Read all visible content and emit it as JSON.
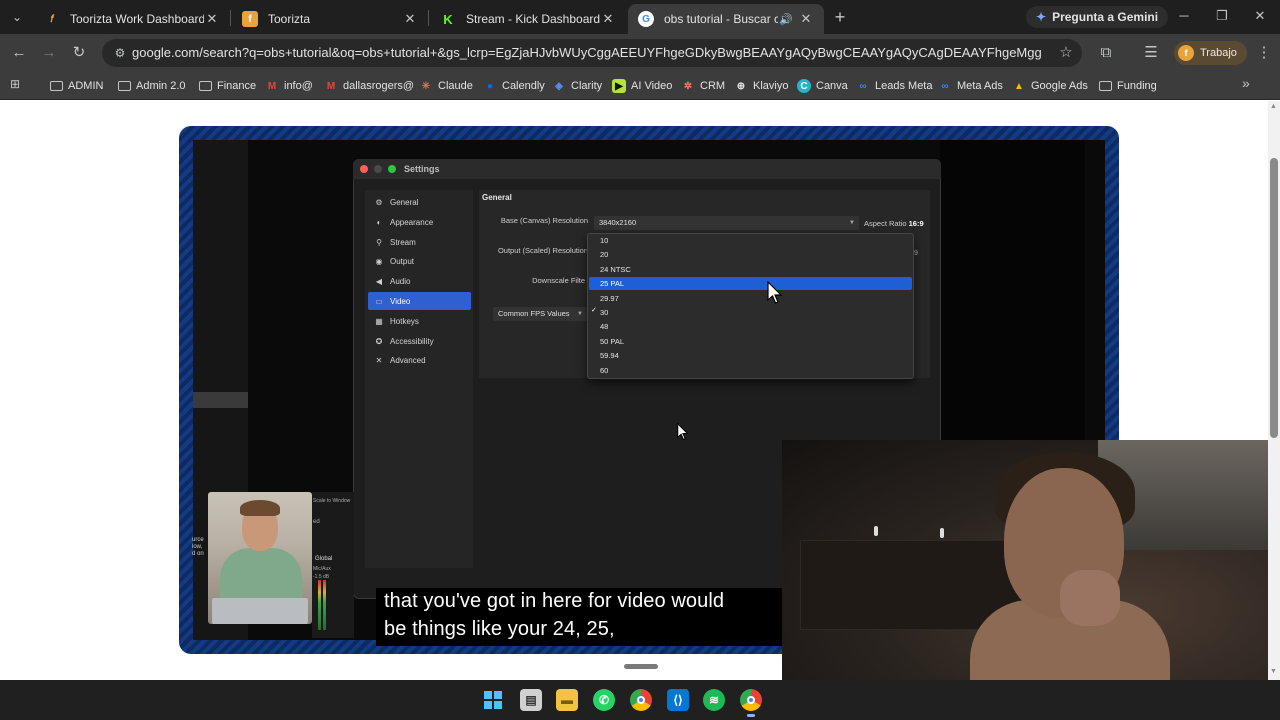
{
  "browser": {
    "tabs": [
      {
        "title": "Toorizta Work Dashboard",
        "favicon": "toorizta-leaf-icon",
        "close": "✕"
      },
      {
        "title": "Toorizta",
        "favicon": "toorizta-icon",
        "close": "✕"
      },
      {
        "title": "Stream - Kick Dashboard",
        "favicon": "kick-icon",
        "close": "✕"
      },
      {
        "title": "obs tutorial - Buscar con Google",
        "favicon": "google-icon",
        "close": "✕",
        "active": true,
        "audio": "🔊"
      }
    ],
    "new_tab": "+",
    "gemini_label": "Pregunta a Gemini",
    "url": "google.com/search?q=obs+tutorial&oq=obs+tutorial+&gs_lcrp=EgZjaHJvbWUyCggAEEUYFhgeGDkyBwgBEAAYgAQyBwgCEAAYgAQyCAgDEAAYFhgeMggIBBAAGBYYHjIICAUQ...",
    "profile_label": "Trabajo",
    "bookmarks": [
      {
        "label": "ADMIN",
        "icon": "folder-icon"
      },
      {
        "label": "Admin 2.0",
        "icon": "folder-icon"
      },
      {
        "label": "Finance",
        "icon": "folder-icon"
      },
      {
        "label": "info@",
        "icon": "gmail-icon"
      },
      {
        "label": "dallasrogers@",
        "icon": "gmail-icon"
      },
      {
        "label": "Claude",
        "icon": "claude-icon"
      },
      {
        "label": "Calendly",
        "icon": "calendly-icon"
      },
      {
        "label": "Clarity",
        "icon": "clarity-icon"
      },
      {
        "label": "AI Video",
        "icon": "ai-video-icon"
      },
      {
        "label": "CRM",
        "icon": "crm-icon"
      },
      {
        "label": "Klaviyo",
        "icon": "klaviyo-icon"
      },
      {
        "label": "Canva",
        "icon": "canva-icon"
      },
      {
        "label": "Leads Meta",
        "icon": "meta-icon"
      },
      {
        "label": "Meta Ads",
        "icon": "meta-icon"
      },
      {
        "label": "Google Ads",
        "icon": "google-ads-icon"
      },
      {
        "label": "Funding",
        "icon": "folder-icon"
      }
    ],
    "bookmarks_more": "»"
  },
  "obs_settings": {
    "window_title": "Settings",
    "sidebar": [
      {
        "label": "General",
        "icon": "gear-icon"
      },
      {
        "label": "Appearance",
        "icon": "palette-icon"
      },
      {
        "label": "Stream",
        "icon": "antenna-icon"
      },
      {
        "label": "Output",
        "icon": "monitor-icon"
      },
      {
        "label": "Audio",
        "icon": "speaker-icon"
      },
      {
        "label": "Video",
        "icon": "display-icon",
        "selected": true
      },
      {
        "label": "Hotkeys",
        "icon": "keyboard-icon"
      },
      {
        "label": "Accessibility",
        "icon": "accessibility-icon"
      },
      {
        "label": "Advanced",
        "icon": "wrench-icon"
      }
    ],
    "section_header": "General",
    "base_resolution_label": "Base (Canvas) Resolution",
    "base_resolution_value": "3840x2160",
    "aspect_ratio_label": "Aspect Ratio",
    "aspect_ratio_value": "16:9",
    "output_resolution_label": "Output (Scaled) Resolution",
    "downscale_filter_label": "Downscale Filte",
    "fps_type_value": "Common FPS Values",
    "fps_options": [
      "10",
      "20",
      "24 NTSC",
      "25 PAL",
      "29.97",
      "30",
      "48",
      "50 PAL",
      "59.94",
      "60"
    ],
    "fps_highlighted": "25 PAL",
    "fps_checked": "30",
    "check_mark": "✓",
    "partial_right": ":9"
  },
  "preview_overlay": {
    "mixer_global": "Global",
    "mixer_aux": "Mic/Aux",
    "mixer_db": "-1.5 dB",
    "scale_text": "Scale to Window",
    "left_snippet": [
      "urce",
      "low,",
      "d on"
    ],
    "partial_ed": "ed"
  },
  "caption": {
    "line1": "that you've got in here for video would",
    "line2": "be things like your 24, 25,"
  },
  "taskbar": {
    "icons": [
      "windows-start-icon",
      "task-view-icon",
      "file-explorer-icon",
      "whatsapp-icon",
      "chrome-icon",
      "vscode-icon",
      "spotify-icon",
      "chrome-profile-icon"
    ]
  }
}
